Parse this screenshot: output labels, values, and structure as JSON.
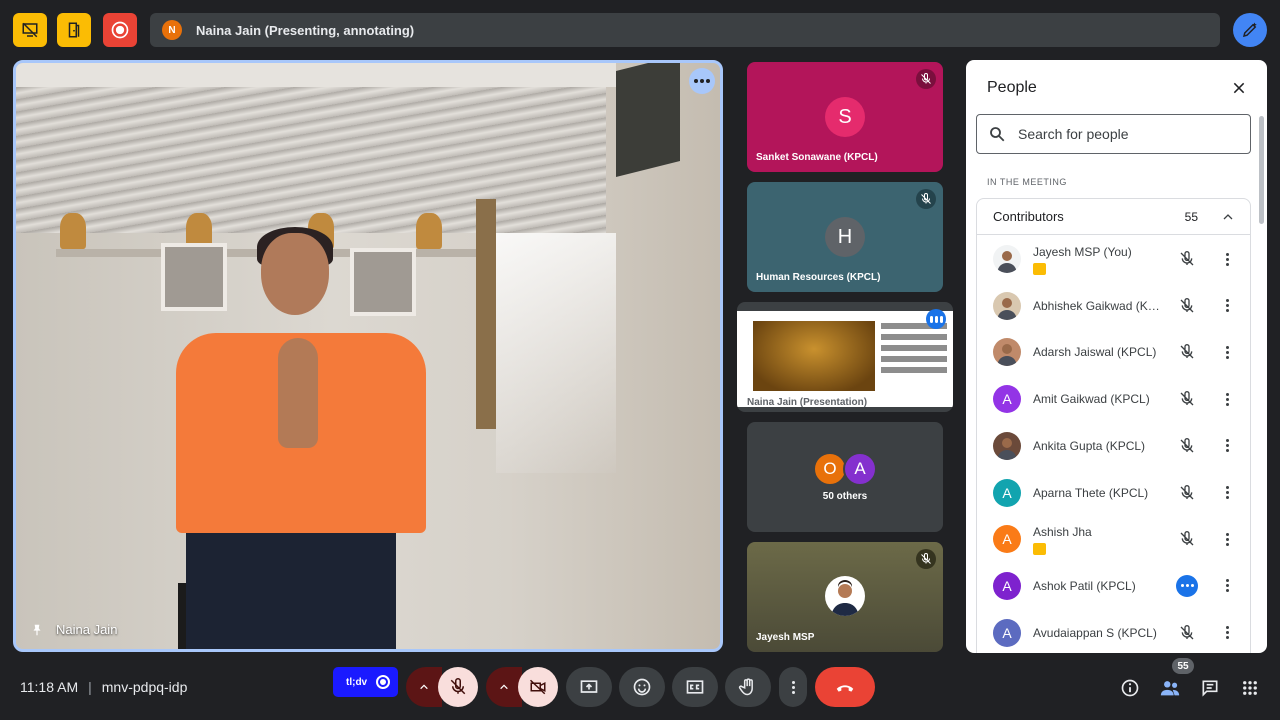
{
  "top_bar": {
    "presenter": {
      "avatar_initial": "N",
      "text": "Naina Jain (Presenting, annotating)"
    }
  },
  "main_tile": {
    "name": "Naina Jain"
  },
  "side_tiles": {
    "sanket": {
      "initial": "S",
      "name": "Sanket Sonawane (KPCL)",
      "bg": "#b3155a",
      "avatar_color": "#e52b6d"
    },
    "hr": {
      "initial": "H",
      "name": "Human Resources (KPCL)",
      "bg": "#3c6470",
      "avatar_color": "#5f6368"
    },
    "presentation": {
      "name": "Naina Jain (Presentation)"
    },
    "others": {
      "initial_1": "O",
      "initial_2": "A",
      "label": "50 others"
    },
    "jayesh": {
      "name": "Jayesh MSP"
    }
  },
  "people_panel": {
    "title": "People",
    "search_placeholder": "Search for people",
    "section_label": "IN THE MEETING",
    "group_label": "Contributors",
    "group_count": "55",
    "people": [
      {
        "name": "Jayesh MSP (You)",
        "initial": "",
        "color": "#f1f3f4",
        "badge": true,
        "action": "mute"
      },
      {
        "name": "Abhishek Gaikwad (KPCL)",
        "initial": "",
        "color": "#d9c8b0",
        "badge": false,
        "action": "mute"
      },
      {
        "name": "Adarsh Jaiswal (KPCL)",
        "initial": "",
        "color": "#c08a6a",
        "badge": false,
        "action": "mute"
      },
      {
        "name": "Amit Gaikwad (KPCL)",
        "initial": "A",
        "color": "#9334e6",
        "badge": false,
        "action": "mute"
      },
      {
        "name": "Ankita Gupta (KPCL)",
        "initial": "",
        "color": "#6b4a3a",
        "badge": false,
        "action": "mute"
      },
      {
        "name": "Aparna Thete (KPCL)",
        "initial": "A",
        "color": "#12a4af",
        "badge": false,
        "action": "mute"
      },
      {
        "name": "Ashish Jha",
        "initial": "A",
        "color": "#fa7b17",
        "badge": true,
        "action": "mute"
      },
      {
        "name": "Ashok Patil (KPCL)",
        "initial": "A",
        "color": "#7e22ce",
        "badge": false,
        "action": "more"
      },
      {
        "name": "Avudaiappan S (KPCL)",
        "initial": "A",
        "color": "#5c6bc0",
        "badge": false,
        "action": "mute"
      }
    ]
  },
  "bottom_bar": {
    "time": "11:18 AM",
    "separator": "|",
    "meeting_code": "mnv-pdpq-idp",
    "tldv_label": "tl;dv",
    "people_count": "55"
  }
}
